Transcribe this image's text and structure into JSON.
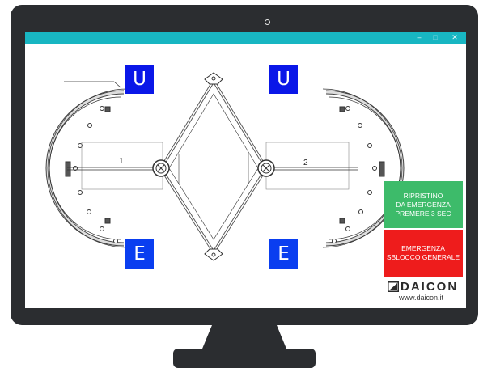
{
  "window": {
    "minimize_glyph": "–",
    "maximize_glyph": "□",
    "close_glyph": "✕"
  },
  "signs": {
    "top_left": "U",
    "top_right": "U",
    "bottom_left": "E",
    "bottom_right": "E"
  },
  "lanes": {
    "left_number": "1",
    "right_number": "2"
  },
  "buttons": {
    "reset_lines": [
      "RIPRISTINO",
      "DA EMERGENZA",
      "PREMERE 3 SEC"
    ],
    "emergency_lines": [
      "EMERGENZA",
      "SBLOCCO GENERALE"
    ]
  },
  "brand": {
    "name": "DAICON",
    "url": "www.daicon.it"
  },
  "colors": {
    "titlebar": "#18b6c2",
    "sign_blue": "#0a17e8",
    "reset_green": "#3dbb6a",
    "emergency_red": "#ee1c1c",
    "monitor": "#2b2d30"
  }
}
